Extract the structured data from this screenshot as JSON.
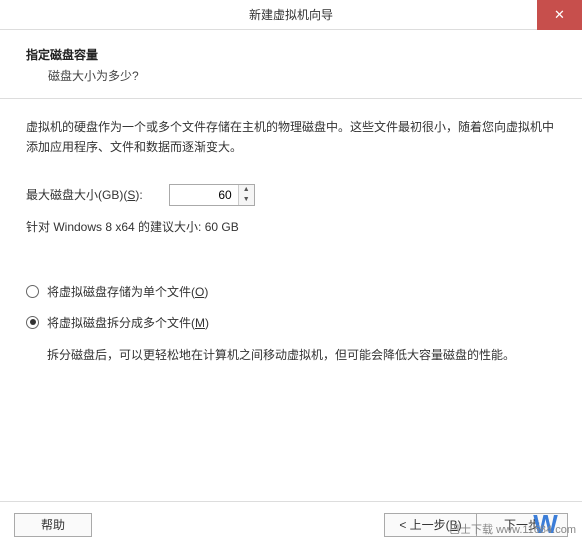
{
  "window": {
    "title": "新建虚拟机向导",
    "close_glyph": "✕"
  },
  "header": {
    "title": "指定磁盘容量",
    "subtitle": "磁盘大小为多少?"
  },
  "main": {
    "description": "虚拟机的硬盘作为一个或多个文件存储在主机的物理磁盘中。这些文件最初很小，随着您向虚拟机中添加应用程序、文件和数据而逐渐变大。",
    "size_label_prefix": "最大磁盘大小(GB)(",
    "size_label_key": "S",
    "size_label_suffix": "):",
    "size_value": "60",
    "recommend": "针对 Windows 8 x64 的建议大小: 60 GB",
    "radios": [
      {
        "prefix": "将虚拟磁盘存储为单个文件(",
        "key": "O",
        "suffix": ")",
        "checked": false
      },
      {
        "prefix": "将虚拟磁盘拆分成多个文件(",
        "key": "M",
        "suffix": ")",
        "checked": true
      }
    ],
    "split_desc": "拆分磁盘后，可以更轻松地在计算机之间移动虚拟机，但可能会降低大容量磁盘的性能。"
  },
  "footer": {
    "help": "帮助",
    "back_prefix": "< 上一步(",
    "back_key": "B",
    "back_suffix": ")",
    "next_prefix": "下一步",
    "next_overlay": "W"
  },
  "watermark_text": "巴士下载\nwww.11684.com"
}
